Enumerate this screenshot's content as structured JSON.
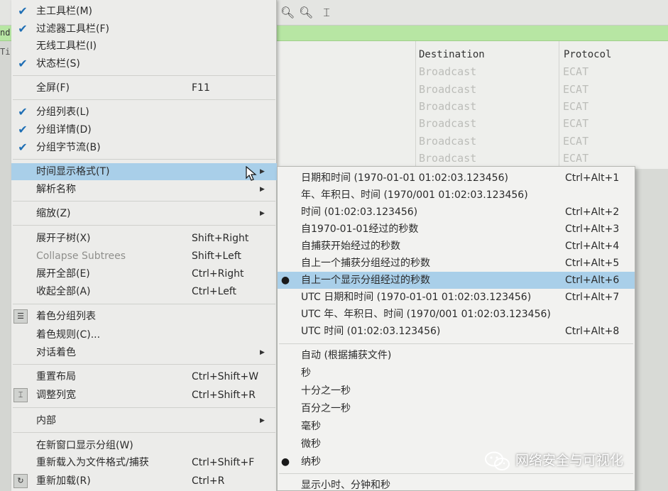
{
  "background": {
    "filter_fragment": "nd",
    "left_strip_fragment": "Ti",
    "columns": [
      "Destination",
      "Protocol"
    ],
    "rows": [
      [
        "Broadcast",
        "ECAT"
      ],
      [
        "Broadcast",
        "ECAT"
      ],
      [
        "Broadcast",
        "ECAT"
      ],
      [
        "Broadcast",
        "ECAT"
      ],
      [
        "Broadcast",
        "ECAT"
      ],
      [
        "Broadcast",
        "ECAT"
      ]
    ]
  },
  "menu": {
    "items": [
      {
        "label": "主工具栏(M)",
        "checked": true
      },
      {
        "label": "过滤器工具栏(F)",
        "checked": true
      },
      {
        "label": "无线工具栏(I)",
        "checked": false
      },
      {
        "label": "状态栏(S)",
        "checked": true
      },
      {
        "label": "全屏(F)",
        "shortcut": "F11"
      },
      {
        "label": "分组列表(L)",
        "checked": true
      },
      {
        "label": "分组详情(D)",
        "checked": true
      },
      {
        "label": "分组字节流(B)",
        "checked": true
      },
      {
        "label": "时间显示格式(T)",
        "submenu": true,
        "highlighted": true
      },
      {
        "label": "解析名称",
        "submenu": true
      },
      {
        "label": "缩放(Z)",
        "submenu": true
      },
      {
        "label": "展开子树(X)",
        "shortcut": "Shift+Right"
      },
      {
        "label": "Collapse Subtrees",
        "shortcut": "Shift+Left",
        "disabled": true
      },
      {
        "label": "展开全部(E)",
        "shortcut": "Ctrl+Right"
      },
      {
        "label": "收起全部(A)",
        "shortcut": "Ctrl+Left"
      },
      {
        "label": "着色分组列表",
        "icon": "colorize-list-icon"
      },
      {
        "label": "着色规则(C)..."
      },
      {
        "label": "对话着色",
        "submenu": true
      },
      {
        "label": "重置布局",
        "shortcut": "Ctrl+Shift+W"
      },
      {
        "label": "调整列宽",
        "shortcut": "Ctrl+Shift+R",
        "icon": "resize-columns-icon"
      },
      {
        "label": "内部",
        "submenu": true
      },
      {
        "label": "在新窗口显示分组(W)"
      },
      {
        "label": "重新载入为文件格式/捕获",
        "shortcut": "Ctrl+Shift+F"
      },
      {
        "label": "重新加载(R)",
        "shortcut": "Ctrl+R",
        "icon": "reload-icon"
      }
    ]
  },
  "submenu": {
    "items": [
      {
        "label": "日期和时间 (1970-01-01 01:02:03.123456)",
        "shortcut": "Ctrl+Alt+1"
      },
      {
        "label": "年、年积日、时间 (1970/001 01:02:03.123456)",
        "shortcut": ""
      },
      {
        "label": "时间 (01:02:03.123456)",
        "shortcut": "Ctrl+Alt+2"
      },
      {
        "label": "自1970-01-01经过的秒数",
        "shortcut": "Ctrl+Alt+3"
      },
      {
        "label": "自捕获开始经过的秒数",
        "shortcut": "Ctrl+Alt+4"
      },
      {
        "label": "自上一个捕获分组经过的秒数",
        "shortcut": "Ctrl+Alt+5"
      },
      {
        "label": "自上一个显示分组经过的秒数",
        "shortcut": "Ctrl+Alt+6",
        "selected": true,
        "highlighted": true
      },
      {
        "label": "UTC 日期和时间 (1970-01-01 01:02:03.123456)",
        "shortcut": "Ctrl+Alt+7"
      },
      {
        "label": "UTC 年、年积日、时间 (1970/001 01:02:03.123456)",
        "shortcut": ""
      },
      {
        "label": "UTC 时间 (01:02:03.123456)",
        "shortcut": "Ctrl+Alt+8"
      },
      {
        "label": "自动 (根据捕获文件)"
      },
      {
        "label": "秒"
      },
      {
        "label": "十分之一秒"
      },
      {
        "label": "百分之一秒"
      },
      {
        "label": "毫秒"
      },
      {
        "label": "微秒"
      },
      {
        "label": "纳秒",
        "selected": true
      },
      {
        "label": "显示小时、分钟和秒"
      }
    ]
  },
  "watermark": {
    "text": "网络安全与可视化"
  },
  "colors": {
    "highlight": "#a9cfe9",
    "check": "#1f6fb5",
    "filter_bar": "#b7e6a3",
    "menu_bg": "#ececea"
  }
}
